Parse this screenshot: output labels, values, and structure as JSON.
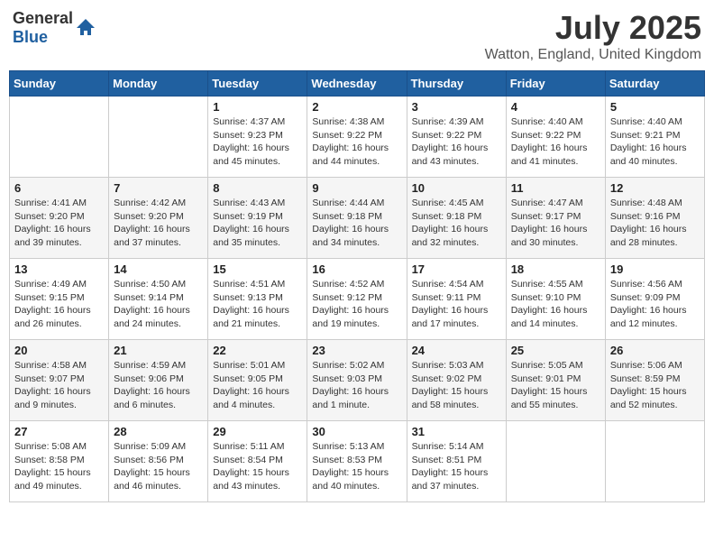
{
  "header": {
    "logo_general": "General",
    "logo_blue": "Blue",
    "month_year": "July 2025",
    "location": "Watton, England, United Kingdom"
  },
  "days_of_week": [
    "Sunday",
    "Monday",
    "Tuesday",
    "Wednesday",
    "Thursday",
    "Friday",
    "Saturday"
  ],
  "weeks": [
    [
      {
        "day": "",
        "sunrise": "",
        "sunset": "",
        "daylight": ""
      },
      {
        "day": "",
        "sunrise": "",
        "sunset": "",
        "daylight": ""
      },
      {
        "day": "1",
        "sunrise": "Sunrise: 4:37 AM",
        "sunset": "Sunset: 9:23 PM",
        "daylight": "Daylight: 16 hours and 45 minutes."
      },
      {
        "day": "2",
        "sunrise": "Sunrise: 4:38 AM",
        "sunset": "Sunset: 9:22 PM",
        "daylight": "Daylight: 16 hours and 44 minutes."
      },
      {
        "day": "3",
        "sunrise": "Sunrise: 4:39 AM",
        "sunset": "Sunset: 9:22 PM",
        "daylight": "Daylight: 16 hours and 43 minutes."
      },
      {
        "day": "4",
        "sunrise": "Sunrise: 4:40 AM",
        "sunset": "Sunset: 9:22 PM",
        "daylight": "Daylight: 16 hours and 41 minutes."
      },
      {
        "day": "5",
        "sunrise": "Sunrise: 4:40 AM",
        "sunset": "Sunset: 9:21 PM",
        "daylight": "Daylight: 16 hours and 40 minutes."
      }
    ],
    [
      {
        "day": "6",
        "sunrise": "Sunrise: 4:41 AM",
        "sunset": "Sunset: 9:20 PM",
        "daylight": "Daylight: 16 hours and 39 minutes."
      },
      {
        "day": "7",
        "sunrise": "Sunrise: 4:42 AM",
        "sunset": "Sunset: 9:20 PM",
        "daylight": "Daylight: 16 hours and 37 minutes."
      },
      {
        "day": "8",
        "sunrise": "Sunrise: 4:43 AM",
        "sunset": "Sunset: 9:19 PM",
        "daylight": "Daylight: 16 hours and 35 minutes."
      },
      {
        "day": "9",
        "sunrise": "Sunrise: 4:44 AM",
        "sunset": "Sunset: 9:18 PM",
        "daylight": "Daylight: 16 hours and 34 minutes."
      },
      {
        "day": "10",
        "sunrise": "Sunrise: 4:45 AM",
        "sunset": "Sunset: 9:18 PM",
        "daylight": "Daylight: 16 hours and 32 minutes."
      },
      {
        "day": "11",
        "sunrise": "Sunrise: 4:47 AM",
        "sunset": "Sunset: 9:17 PM",
        "daylight": "Daylight: 16 hours and 30 minutes."
      },
      {
        "day": "12",
        "sunrise": "Sunrise: 4:48 AM",
        "sunset": "Sunset: 9:16 PM",
        "daylight": "Daylight: 16 hours and 28 minutes."
      }
    ],
    [
      {
        "day": "13",
        "sunrise": "Sunrise: 4:49 AM",
        "sunset": "Sunset: 9:15 PM",
        "daylight": "Daylight: 16 hours and 26 minutes."
      },
      {
        "day": "14",
        "sunrise": "Sunrise: 4:50 AM",
        "sunset": "Sunset: 9:14 PM",
        "daylight": "Daylight: 16 hours and 24 minutes."
      },
      {
        "day": "15",
        "sunrise": "Sunrise: 4:51 AM",
        "sunset": "Sunset: 9:13 PM",
        "daylight": "Daylight: 16 hours and 21 minutes."
      },
      {
        "day": "16",
        "sunrise": "Sunrise: 4:52 AM",
        "sunset": "Sunset: 9:12 PM",
        "daylight": "Daylight: 16 hours and 19 minutes."
      },
      {
        "day": "17",
        "sunrise": "Sunrise: 4:54 AM",
        "sunset": "Sunset: 9:11 PM",
        "daylight": "Daylight: 16 hours and 17 minutes."
      },
      {
        "day": "18",
        "sunrise": "Sunrise: 4:55 AM",
        "sunset": "Sunset: 9:10 PM",
        "daylight": "Daylight: 16 hours and 14 minutes."
      },
      {
        "day": "19",
        "sunrise": "Sunrise: 4:56 AM",
        "sunset": "Sunset: 9:09 PM",
        "daylight": "Daylight: 16 hours and 12 minutes."
      }
    ],
    [
      {
        "day": "20",
        "sunrise": "Sunrise: 4:58 AM",
        "sunset": "Sunset: 9:07 PM",
        "daylight": "Daylight: 16 hours and 9 minutes."
      },
      {
        "day": "21",
        "sunrise": "Sunrise: 4:59 AM",
        "sunset": "Sunset: 9:06 PM",
        "daylight": "Daylight: 16 hours and 6 minutes."
      },
      {
        "day": "22",
        "sunrise": "Sunrise: 5:01 AM",
        "sunset": "Sunset: 9:05 PM",
        "daylight": "Daylight: 16 hours and 4 minutes."
      },
      {
        "day": "23",
        "sunrise": "Sunrise: 5:02 AM",
        "sunset": "Sunset: 9:03 PM",
        "daylight": "Daylight: 16 hours and 1 minute."
      },
      {
        "day": "24",
        "sunrise": "Sunrise: 5:03 AM",
        "sunset": "Sunset: 9:02 PM",
        "daylight": "Daylight: 15 hours and 58 minutes."
      },
      {
        "day": "25",
        "sunrise": "Sunrise: 5:05 AM",
        "sunset": "Sunset: 9:01 PM",
        "daylight": "Daylight: 15 hours and 55 minutes."
      },
      {
        "day": "26",
        "sunrise": "Sunrise: 5:06 AM",
        "sunset": "Sunset: 8:59 PM",
        "daylight": "Daylight: 15 hours and 52 minutes."
      }
    ],
    [
      {
        "day": "27",
        "sunrise": "Sunrise: 5:08 AM",
        "sunset": "Sunset: 8:58 PM",
        "daylight": "Daylight: 15 hours and 49 minutes."
      },
      {
        "day": "28",
        "sunrise": "Sunrise: 5:09 AM",
        "sunset": "Sunset: 8:56 PM",
        "daylight": "Daylight: 15 hours and 46 minutes."
      },
      {
        "day": "29",
        "sunrise": "Sunrise: 5:11 AM",
        "sunset": "Sunset: 8:54 PM",
        "daylight": "Daylight: 15 hours and 43 minutes."
      },
      {
        "day": "30",
        "sunrise": "Sunrise: 5:13 AM",
        "sunset": "Sunset: 8:53 PM",
        "daylight": "Daylight: 15 hours and 40 minutes."
      },
      {
        "day": "31",
        "sunrise": "Sunrise: 5:14 AM",
        "sunset": "Sunset: 8:51 PM",
        "daylight": "Daylight: 15 hours and 37 minutes."
      },
      {
        "day": "",
        "sunrise": "",
        "sunset": "",
        "daylight": ""
      },
      {
        "day": "",
        "sunrise": "",
        "sunset": "",
        "daylight": ""
      }
    ]
  ]
}
